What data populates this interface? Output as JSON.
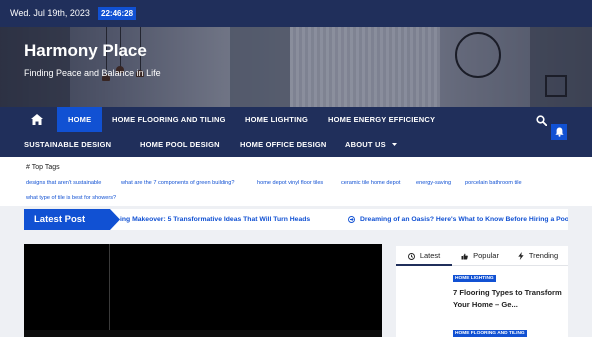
{
  "topbar": {
    "date": "Wed. Jul 19th, 2023",
    "time": "22:46:28"
  },
  "site": {
    "title": "Harmony Place",
    "tagline": "Finding Peace and Balance in Life"
  },
  "nav": {
    "row1": [
      "HOME",
      "HOME FLOORING AND TILING",
      "HOME LIGHTING",
      "HOME ENERGY EFFICIENCY"
    ],
    "row2": [
      "SUSTAINABLE DESIGN",
      "HOME POOL DESIGN",
      "HOME OFFICE DESIGN",
      "ABOUT US"
    ],
    "home_icon": "home-icon",
    "search_icon": "search-icon",
    "bell_icon": "bell-icon"
  },
  "top_tags": {
    "label": "Top Tags",
    "tags": [
      "designs that aren't sustainable",
      "what are the 7 components of green building?",
      "home depot vinyl floor tiles",
      "ceramic tile home depot",
      "energy-saving",
      "porcelain bathroom tile",
      "what type of tile is best for showers?"
    ]
  },
  "ticker": {
    "label": "Latest Post",
    "items": [
      "ing Makeover: 5 Transformative Ideas That Will Turn Heads",
      "Dreaming of an Oasis? Here's What to Know Before Hiring a Pool Design"
    ]
  },
  "sidebar": {
    "tabs": [
      "Latest",
      "Popular",
      "Trending"
    ],
    "posts": [
      {
        "category": "HOME LIGHTING",
        "title": "7 Flooring Types to Transform Your Home – Ge..."
      },
      {
        "category": "HOME FLOORING AND TILING",
        "title": ""
      }
    ]
  },
  "colors": {
    "navy": "#202f5b",
    "accent": "#1151d3"
  }
}
